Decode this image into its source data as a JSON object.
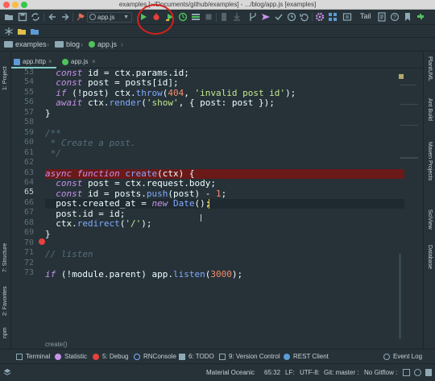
{
  "window": {
    "title": "examples [~/Documents/github/examples] - .../blog/app.js [examples]"
  },
  "toolbar": {
    "run_config": "app.js",
    "tail_label": "Tail"
  },
  "breadcrumb": {
    "items": [
      "examples",
      "blog",
      "app.js"
    ]
  },
  "tabs": [
    {
      "label": "app.http",
      "active": true
    },
    {
      "label": "app.js",
      "active": false
    }
  ],
  "left_strip": {
    "project": "1: Project",
    "structure": "7: Structure",
    "favorites": "2: Favorites",
    "npm": "npm"
  },
  "right_strip": {
    "plantuml": "PlantUML",
    "ant": "Ant Build",
    "maven": "Maven Projects",
    "sciview": "SciView",
    "database": "Database"
  },
  "editor": {
    "line_numbers": [
      "53",
      "54",
      "55",
      "56",
      "57",
      "58",
      "59",
      "60",
      "61",
      "62",
      "63",
      "64",
      "65",
      "66",
      "67",
      "68",
      "69",
      "70",
      "71",
      "72",
      "73"
    ],
    "current_line": "65",
    "breakpoint_line": "62"
  },
  "footer_crumb": "create()",
  "bottom_tools": {
    "terminal": "Terminal",
    "statistic": "Statistic",
    "debug": "5: Debug",
    "rnconsole": "RNConsole",
    "todo": "6: TODO",
    "vcs": "9: Version Control",
    "rest": "REST Client",
    "eventlog": "Event Log"
  },
  "status": {
    "theme": "Material Oceanic",
    "position": "65:32",
    "line_sep": "LF:",
    "encoding": "UTF-8:",
    "git": "Git: master :",
    "gitflow": "No Gitflow :"
  },
  "colors": {
    "bg": "#263238",
    "keyword": "#c792ea",
    "function": "#82aaff",
    "string": "#c3e88d",
    "number": "#f78c6c",
    "comment": "#546e7a",
    "breakpoint": "#e8403a",
    "accent": "#80cbc4"
  }
}
